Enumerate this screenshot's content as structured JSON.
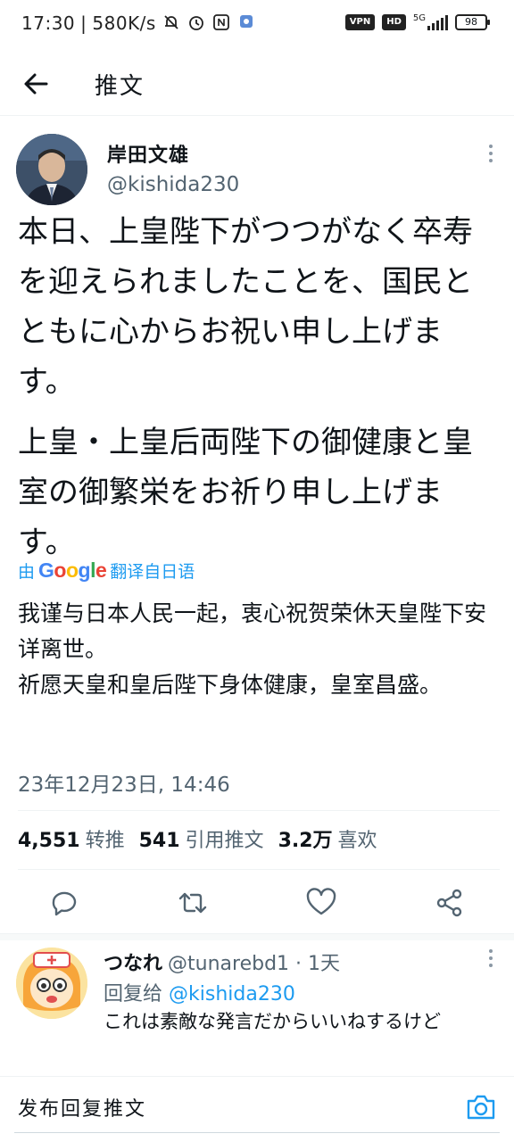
{
  "status_bar": {
    "time": "17:30",
    "speed": "580K/s",
    "battery": "98",
    "vpn": "VPN",
    "hd": "HD",
    "network": "5G"
  },
  "header": {
    "title": "推文"
  },
  "tweet": {
    "author_name": "岸田文雄",
    "author_handle": "@kishida230",
    "text_paragraphs": [
      "本日、上皇陛下がつつがなく卒寿を迎えられましたことを、国民とともに心からお祝い申し上げます。",
      "上皇・上皇后両陛下の御健康と皇室の御繁栄をお祈り申し上げます。"
    ],
    "translate_prefix": "由",
    "translate_brand": "Google",
    "translate_suffix": "翻译自日语",
    "translation_paragraphs": [
      "我谨与日本人民一起，衷心祝贺荣休天皇陛下安详离世。",
      "祈愿天皇和皇后陛下身体健康，皇室昌盛。"
    ],
    "timestamp": "23年12月23日, 14:46",
    "retweets_count": "4,551",
    "retweets_label": "转推",
    "quotes_count": "541",
    "quotes_label": "引用推文",
    "likes_count": "3.2万",
    "likes_label": "喜欢"
  },
  "reply": {
    "name": "つなれ",
    "handle": "@tunarebd1",
    "time": "· 1天",
    "reply_to_label": "回复给",
    "reply_to_handle": "@kishida230",
    "text": "これは素敵な発言だからいいねするけど"
  },
  "compose": {
    "placeholder": "发布回复推文"
  },
  "colors": {
    "accent": "#1d9bf0",
    "text": "#0f1419",
    "muted": "#536471"
  }
}
